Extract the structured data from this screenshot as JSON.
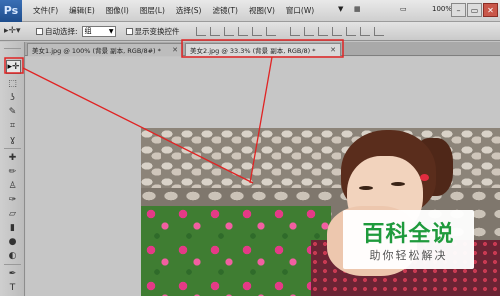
{
  "app": {
    "logo_text": "Ps"
  },
  "menu": {
    "items": [
      "文件(F)",
      "编辑(E)",
      "图像(I)",
      "图层(L)",
      "选择(S)",
      "滤镜(T)",
      "视图(V)",
      "窗口(W)"
    ],
    "zoom_value": "100%",
    "extras": [
      "▼",
      "▦",
      "▭",
      "▼"
    ]
  },
  "window_controls": {
    "minimize": "–",
    "restore": "▭",
    "close": "✕"
  },
  "options_bar": {
    "auto_select_label": "自动选择:",
    "auto_select_value": "组",
    "show_transform_label": "显示变换控件"
  },
  "tabs": [
    {
      "label": "美女1.jpg @ 100% (背景 副本, RGB/8#) *",
      "close": "✕"
    },
    {
      "label": "美女2.jpg @ 33.3% (背景 副本, RGB/8) *",
      "close": "✕"
    }
  ],
  "tools": {
    "move": "▸✛",
    "icons": [
      "marquee-icon",
      "lasso-icon",
      "quick-select-icon",
      "crop-icon",
      "eyedropper-icon",
      "healing-brush-icon",
      "brush-icon",
      "stamp-icon",
      "history-brush-icon",
      "eraser-icon",
      "gradient-icon",
      "blur-icon",
      "dodge-icon",
      "pen-icon",
      "type-icon"
    ],
    "glyphs": [
      "⬚",
      "ʖ",
      "✎",
      "⌗",
      "ɣ",
      "✚",
      "✏",
      "♙",
      "✑",
      "▱",
      "▮",
      "●",
      "◐",
      "✒",
      "T"
    ]
  },
  "watermark": {
    "title": "百科全说",
    "subtitle": "助你轻松解决"
  },
  "colors": {
    "annotation_red": "#e02424",
    "watermark_green": "#1f9a3c"
  }
}
